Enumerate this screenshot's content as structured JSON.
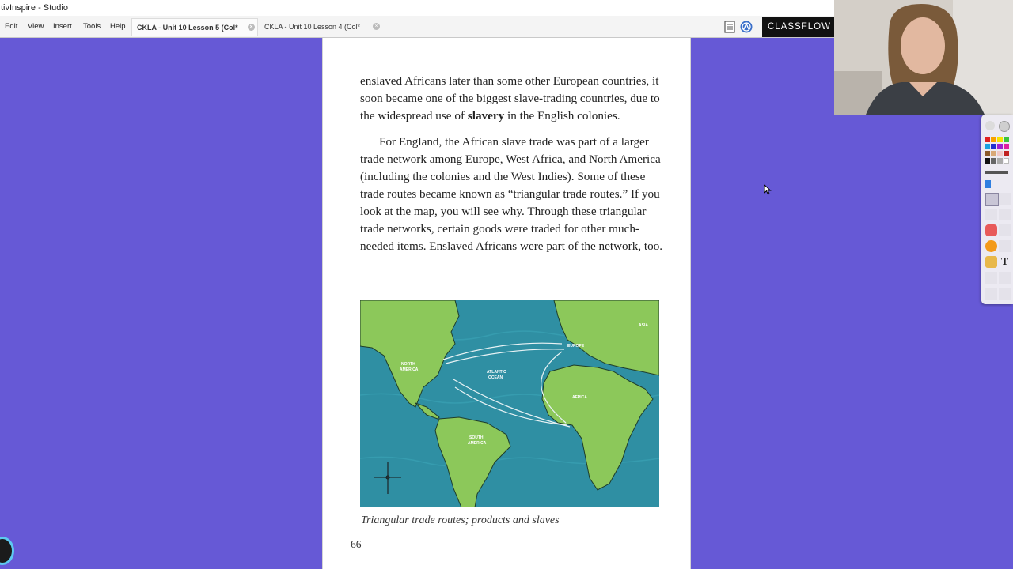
{
  "app": {
    "title": "tivInspire - Studio"
  },
  "menu": [
    "Edit",
    "View",
    "Insert",
    "Tools",
    "Help"
  ],
  "tabs": [
    {
      "label": "CKLA - Unit 10 Lesson 5 (Col*",
      "active": true
    },
    {
      "label": "CKLA - Unit 10 Lesson 4 (Col*",
      "active": false
    }
  ],
  "brand": {
    "label": "CLASSFLOW"
  },
  "document": {
    "para1_before": "enslaved Africans later than some other European countries, it soon became one of the biggest slave-trading countries, due to the widespread use of ",
    "para1_bold": "slavery",
    "para1_after": " in the English colonies.",
    "para2": "For England, the African slave trade was part of a larger trade network among Europe, West Africa, and North America (including the colonies and the West Indies). Some of these trade routes became known as “triangular trade routes.” If you look at the map, you will see why. Through these triangular trade networks, certain goods were traded for other much-needed items. Enslaved Africans were part of the network, too.",
    "map_caption": "Triangular trade routes; products and slaves",
    "page_number": "66"
  },
  "map_labels": {
    "north_america": [
      "NORTH",
      "AMERICA"
    ],
    "south_america": [
      "SOUTH",
      "AMERICA"
    ],
    "europe": "EUROPE",
    "africa": "AFRICA",
    "atlantic": [
      "ATLANTIC",
      "OCEAN"
    ],
    "asia": "ASIA"
  },
  "colors": {
    "canvas_background": "#6659d6",
    "ocean": "#2f8fa3",
    "land": "#8cc85a",
    "page": "#ffffff"
  }
}
